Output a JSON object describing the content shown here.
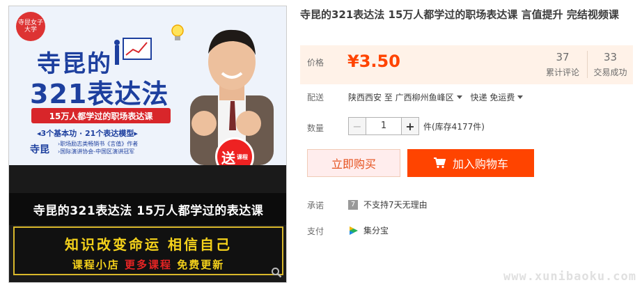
{
  "product": {
    "title": "寺昆的321表达法 15万人都学过的职场表达课 言值提升 完结视频课"
  },
  "banner": {
    "logo_text": "寺昆女子大学",
    "hero_title_1": "寺昆的",
    "hero_title_2": "321表达法",
    "ribbon": "15万人都学过的职场表达课",
    "subline": "◂3个基本功 · 21个表达模型▸",
    "author_name": "寺昆",
    "author_info_1": "›职场励志类畅销书《言值》作者",
    "author_info_2": "›国际演讲协会-中国区演讲冠军",
    "gift_label": "送",
    "gift_small": "课程",
    "caption": "寺昆的321表达法  15万人都学过的表达课",
    "promo_line1": "知识改变命运   相信自己",
    "promo_shop": "课程小店",
    "promo_more": "更多课程",
    "promo_free": "免费更新"
  },
  "price": {
    "label": "价格",
    "value": "¥3.50",
    "reviews_count": "37",
    "reviews_label": "累计评论",
    "sales_count": "33",
    "sales_label": "交易成功"
  },
  "shipping": {
    "label": "配送",
    "from": "陕西西安 至",
    "to": "广西柳州鱼峰区",
    "method": "快递 免运费"
  },
  "quantity": {
    "label": "数量",
    "minus": "−",
    "value": "1",
    "plus": "+",
    "stock": "件(库存4177件)"
  },
  "actions": {
    "buy_now": "立即购买",
    "add_cart": "加入购物车"
  },
  "promise": {
    "label": "承诺",
    "icon_glyph": "7",
    "text": "不支持7天无理由"
  },
  "payment": {
    "label": "支付",
    "text": "集分宝"
  },
  "watermark": "www.xunibaoku.com",
  "colors": {
    "accent": "#ff4400",
    "price": "#ff4400",
    "banner_blue": "#1d3f9e",
    "promo_yellow": "#f4d11b"
  }
}
